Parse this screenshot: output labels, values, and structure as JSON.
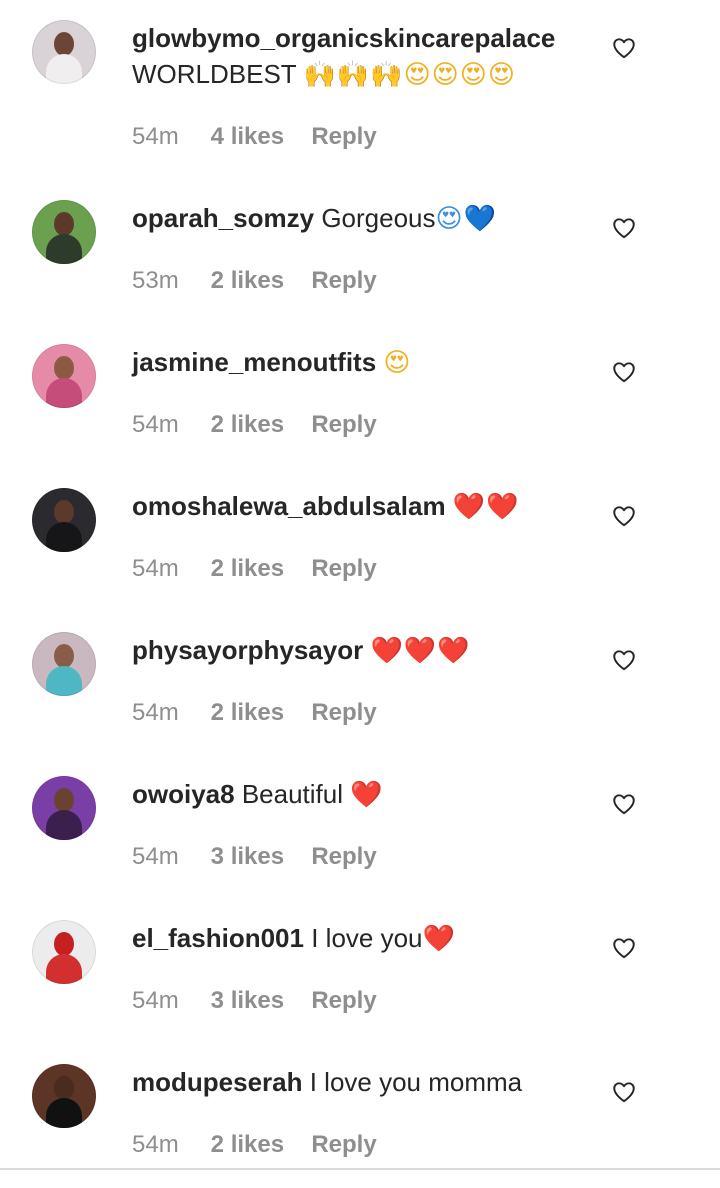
{
  "comments": [
    {
      "username": "glowbymo_organicskincarepalace",
      "text": "WORLDBEST",
      "emoji": "🙌🙌🙌😍😍😍😍",
      "emoji_tone": "gold",
      "second_line": true,
      "time": "54m",
      "likes": "4 likes",
      "reply": "Reply",
      "avatar": {
        "bg": "#d9d2d6",
        "skin": "#6b4636",
        "outfit": "#f1eef0"
      }
    },
    {
      "username": "oparah_somzy",
      "text": "Gorgeous",
      "emoji": "😍💙",
      "emoji_tone": "blue",
      "time": "53m",
      "likes": "2 likes",
      "reply": "Reply",
      "avatar": {
        "bg": "#6aa04e",
        "skin": "#5b3a2a",
        "outfit": "#2f3b2a"
      }
    },
    {
      "username": "jasmine_menoutfits",
      "text": "",
      "emoji": "😍",
      "emoji_tone": "gold",
      "time": "54m",
      "likes": "2 likes",
      "reply": "Reply",
      "avatar": {
        "bg": "#e58aa7",
        "skin": "#8c5a44",
        "outfit": "#c44d7a"
      }
    },
    {
      "username": "omoshalewa_abdulsalam",
      "text": "",
      "emoji": "❤️❤️",
      "emoji_tone": "red",
      "time": "54m",
      "likes": "2 likes",
      "reply": "Reply",
      "avatar": {
        "bg": "#2b2b2f",
        "skin": "#5a3a2b",
        "outfit": "#161618"
      }
    },
    {
      "username": "physayorphysayor",
      "text": "",
      "emoji": "❤️❤️❤️",
      "emoji_tone": "red",
      "time": "54m",
      "likes": "2 likes",
      "reply": "Reply",
      "avatar": {
        "bg": "#c9b8bf",
        "skin": "#8a5c4a",
        "outfit": "#4fb7c4"
      }
    },
    {
      "username": "owoiya8",
      "text": "Beautiful",
      "emoji": "❤️",
      "emoji_tone": "red",
      "time": "54m",
      "likes": "3 likes",
      "reply": "Reply",
      "avatar": {
        "bg": "#7a3fa6",
        "skin": "#6a4232",
        "outfit": "#3a1f4f"
      }
    },
    {
      "username": "el_fashion001",
      "text": "I love you",
      "emoji": "❤️",
      "emoji_tone": "red",
      "time": "54m",
      "likes": "3 likes",
      "reply": "Reply",
      "avatar": {
        "bg": "#ececec",
        "skin": "#c61f1f",
        "outfit": "#d23030"
      }
    },
    {
      "username": "modupeserah",
      "text": "I love you momma",
      "emoji": "",
      "emoji_tone": "red",
      "time": "54m",
      "likes": "2 likes",
      "reply": "Reply",
      "avatar": {
        "bg": "#5c3526",
        "skin": "#4a2b1f",
        "outfit": "#111111"
      }
    }
  ],
  "icons": {
    "like": "heart-outline-icon"
  },
  "colors": {
    "text": "#262626",
    "meta": "#8e8e8e",
    "divider": "#dbdbdb"
  }
}
